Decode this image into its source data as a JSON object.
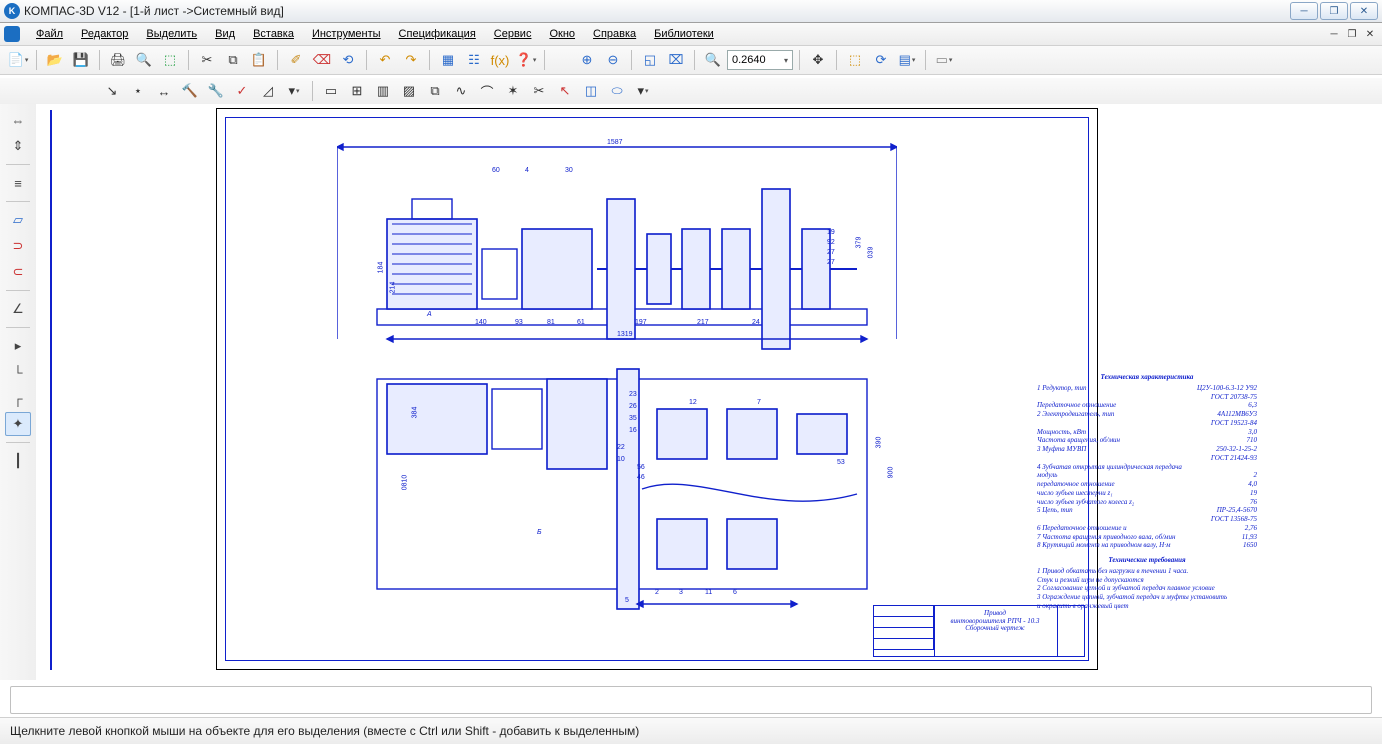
{
  "title": "КОМПАС-3D V12 - [1-й лист ->Системный вид]",
  "menu": [
    "Файл",
    "Редактор",
    "Выделить",
    "Вид",
    "Вставка",
    "Инструменты",
    "Спецификация",
    "Сервис",
    "Окно",
    "Справка",
    "Библиотеки"
  ],
  "zoom": "0.2640",
  "status": "Щелкните левой кнопкой мыши на объекте для его выделения (вместе с Ctrl или Shift - добавить к выделенным)",
  "tech_char_header": "Техническая характеристика",
  "tech_req_header": "Технические требования",
  "tc": [
    {
      "l": "1 Редуктор, тип",
      "r": "Ц2У-100-6.3-12 У92"
    },
    {
      "l": "",
      "r": "ГОСТ 20738-75"
    },
    {
      "l": "  Передаточное отношение",
      "r": "6,3"
    },
    {
      "l": "2 Электродвигатель, тип",
      "r": "4А112МВ6У3"
    },
    {
      "l": "",
      "r": "ГОСТ 19523-84"
    },
    {
      "l": "  Мощность, кВт",
      "r": "3,0"
    },
    {
      "l": "  Частота вращения, об/мин",
      "r": "710"
    },
    {
      "l": "3 Муфта   МУВП",
      "r": "250-32-1-25-2"
    },
    {
      "l": "",
      "r": "ГОСТ 21424-93"
    },
    {
      "l": "4 Зубчатая открытая цилиндрическая передача",
      "r": ""
    },
    {
      "l": "  модуль",
      "r": "2"
    },
    {
      "l": "  передаточное отношение",
      "r": "4,0"
    },
    {
      "l": "  число зубьев шестерни z₁",
      "r": "19"
    },
    {
      "l": "  число зубьев зубчатого колеса z₂",
      "r": "76"
    },
    {
      "l": "5 Цепь, тип",
      "r": "ПР-25,4-5670"
    },
    {
      "l": "",
      "r": "ГОСТ 13568-75"
    },
    {
      "l": "6 Передаточное отношение u",
      "r": "2,76"
    },
    {
      "l": "7 Частота вращения приводного вала, об/мин",
      "r": "11,93"
    },
    {
      "l": "8 Крутящий момент на приводном валу, Н·м",
      "r": "1650"
    }
  ],
  "tr": [
    "1 Привод обкатать без нагрузки в течении    1 часа.",
    "   Стук и резкий шум не допускаются",
    "2 Согласование цепной и зубчатой передач плавное условие",
    "3 Ограждение цепной, зубчатой передач и муфты установить",
    "   и окрасить в оранжевый цвет"
  ],
  "stamp": {
    "l1": "Привод",
    "l2": "винтоворошителя РПЧ - 10.3",
    "l3": "Сборочный чертеж"
  },
  "dims_top": {
    "overall": "1587",
    "base": "1319"
  },
  "dims_bottom": [
    "140",
    "93",
    "81",
    "61",
    "197",
    "217",
    "24"
  ],
  "callouts_top": [
    "60",
    "4",
    "30"
  ],
  "callouts_right_top": [
    "19",
    "92",
    "27",
    "27"
  ],
  "dims_side_top": [
    "184",
    "214",
    "379",
    "039"
  ],
  "callouts_plan_right": [
    "23",
    "26",
    "35",
    "16",
    "12",
    "7",
    "22",
    "10"
  ],
  "callouts_plan_far": [
    "56",
    "46",
    "53"
  ],
  "callouts_plan_bottom": [
    "5",
    "2",
    "3",
    "11",
    "6"
  ],
  "dims_plan_left": [
    "0810",
    "384"
  ],
  "dims_plan_right": [
    "390",
    "900"
  ],
  "section_A": "А",
  "section_B": "Б"
}
